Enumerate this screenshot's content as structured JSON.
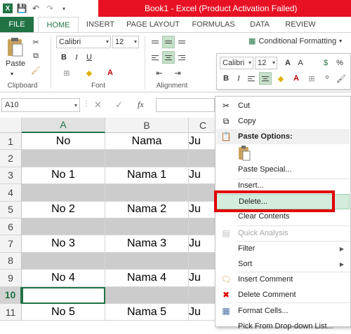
{
  "title_bar": {
    "text": "Book1 -  Excel (Product Activation Failed)",
    "accent": "#e81123"
  },
  "ribbon_tabs": [
    "FILE",
    "HOME",
    "INSERT",
    "PAGE LAYOUT",
    "FORMULAS",
    "DATA",
    "REVIEW"
  ],
  "ribbon": {
    "font_name": "Calibri",
    "font_size": "12",
    "mini_font_name": "Calibri",
    "mini_font_size": "12",
    "paste_label": "Paste",
    "groups": {
      "clipboard": "Clipboard",
      "font": "Font",
      "alignment": "Alignment"
    },
    "conditional_formatting": "Conditional Formatting",
    "percent": "%"
  },
  "formula_bar": {
    "name_box": "A10",
    "fx": "fx"
  },
  "grid": {
    "columns": [
      "A",
      "B",
      "C"
    ],
    "rows": [
      {
        "num": "1",
        "a": "No",
        "b": "Nama",
        "c": "Ju",
        "gray": false
      },
      {
        "num": "2",
        "a": "",
        "b": "",
        "c": "",
        "gray": true
      },
      {
        "num": "3",
        "a": "No 1",
        "b": "Nama 1",
        "c": "Ju",
        "gray": false
      },
      {
        "num": "4",
        "a": "",
        "b": "",
        "c": "",
        "gray": true
      },
      {
        "num": "5",
        "a": "No 2",
        "b": "Nama 2",
        "c": "Ju",
        "gray": false
      },
      {
        "num": "6",
        "a": "",
        "b": "",
        "c": "",
        "gray": true
      },
      {
        "num": "7",
        "a": "No 3",
        "b": "Nama 3",
        "c": "Ju",
        "gray": false
      },
      {
        "num": "8",
        "a": "",
        "b": "",
        "c": "",
        "gray": true
      },
      {
        "num": "9",
        "a": "No 4",
        "b": "Nama 4",
        "c": "Ju",
        "gray": false
      },
      {
        "num": "10",
        "a": "",
        "b": "",
        "c": "",
        "gray": true
      },
      {
        "num": "11",
        "a": "No 5",
        "b": "Nama 5",
        "c": "Ju",
        "gray": false
      }
    ]
  },
  "context_menu": {
    "cut": "Cut",
    "copy": "Copy",
    "paste_options": "Paste Options:",
    "paste_special": "Paste Special...",
    "insert": "Insert...",
    "delete": "Delete...",
    "clear_contents": "Clear Contents",
    "quick_analysis": "Quick Analysis",
    "filter": "Filter",
    "sort": "Sort",
    "insert_comment": "Insert Comment",
    "delete_comment": "Delete Comment",
    "format_cells": "Format Cells...",
    "pick_from_list": "Pick From Drop-down List..."
  },
  "colors": {
    "excel_green": "#217346",
    "highlight": "#d3ecdc",
    "callout": "#e00000"
  }
}
